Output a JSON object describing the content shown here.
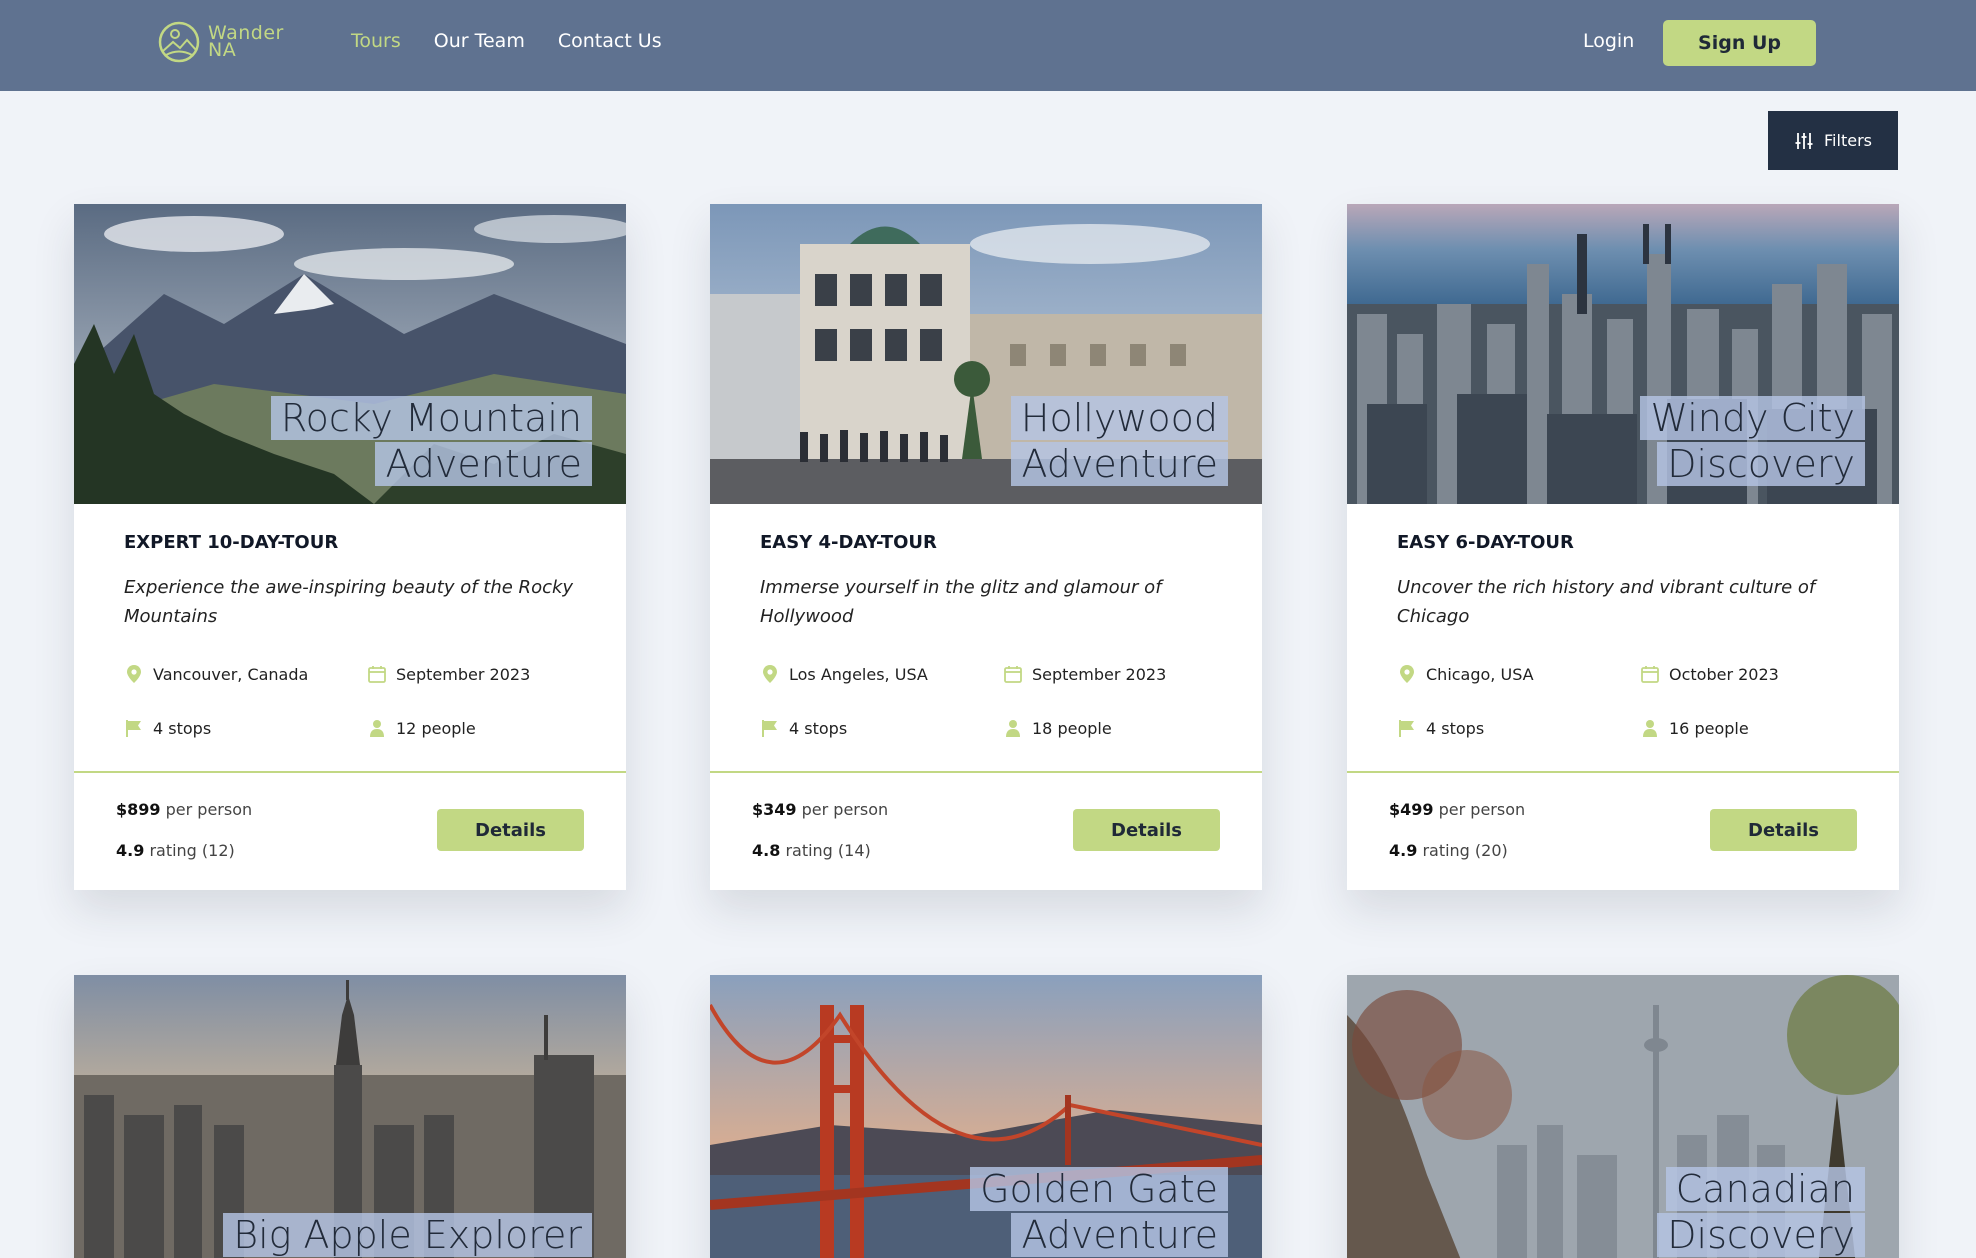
{
  "brand": {
    "line1": "Wander",
    "line2": "NA"
  },
  "nav": {
    "tours": "Tours",
    "team": "Our Team",
    "contact": "Contact Us"
  },
  "auth": {
    "login": "Login",
    "signup": "Sign Up"
  },
  "filters_label": "Filters",
  "colors": {
    "header": "#5f7290",
    "accent": "#c2d884",
    "dark": "#233044",
    "background": "#f0f3f8"
  },
  "tours": [
    {
      "title_line1": "Rocky Mountain",
      "title_line2": "Adventure",
      "difficulty": "Expert 10-day-tour",
      "summary": "Experience the awe-inspiring beauty of the Rocky Mountains",
      "location": "Vancouver, Canada",
      "date": "September 2023",
      "stops": "4 stops",
      "people": "12 people",
      "price": "$899",
      "price_suffix": "per person",
      "rating": "4.9",
      "rating_suffix": "rating (12)",
      "details": "Details"
    },
    {
      "title_line1": "Hollywood",
      "title_line2": "Adventure",
      "difficulty": "Easy 4-day-tour",
      "summary": "Immerse yourself in the glitz and glamour of Hollywood",
      "location": "Los Angeles, USA",
      "date": "September 2023",
      "stops": "4 stops",
      "people": "18 people",
      "price": "$349",
      "price_suffix": "per person",
      "rating": "4.8",
      "rating_suffix": "rating (14)",
      "details": "Details"
    },
    {
      "title_line1": "Windy City",
      "title_line2": "Discovery",
      "difficulty": "Easy 6-day-tour",
      "summary": "Uncover the rich history and vibrant culture of Chicago",
      "location": "Chicago, USA",
      "date": "October 2023",
      "stops": "4 stops",
      "people": "16 people",
      "price": "$499",
      "price_suffix": "per person",
      "rating": "4.9",
      "rating_suffix": "rating (20)",
      "details": "Details"
    },
    {
      "title_line1": "Big Apple Explorer",
      "title_line2": ""
    },
    {
      "title_line1": "Golden Gate",
      "title_line2": "Adventure"
    },
    {
      "title_line1": "Canadian",
      "title_line2": "Discovery"
    }
  ]
}
